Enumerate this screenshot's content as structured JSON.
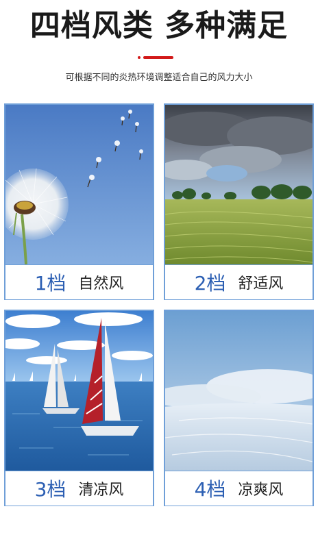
{
  "header": {
    "title": "四档风类 多种满足",
    "subtitle": "可根据不同的炎热环境调整适合自己的风力大小"
  },
  "cards": [
    {
      "level": "1档",
      "wind": "自然风",
      "image": "dandelion"
    },
    {
      "level": "2档",
      "wind": "舒适风",
      "image": "wheat-field"
    },
    {
      "level": "3档",
      "wind": "清凉风",
      "image": "sailboats"
    },
    {
      "level": "4档",
      "wind": "凉爽风",
      "image": "snow-field"
    }
  ],
  "colors": {
    "accent": "#d21a1a",
    "border": "#6f9fd8",
    "level_text": "#2c5fb3"
  }
}
